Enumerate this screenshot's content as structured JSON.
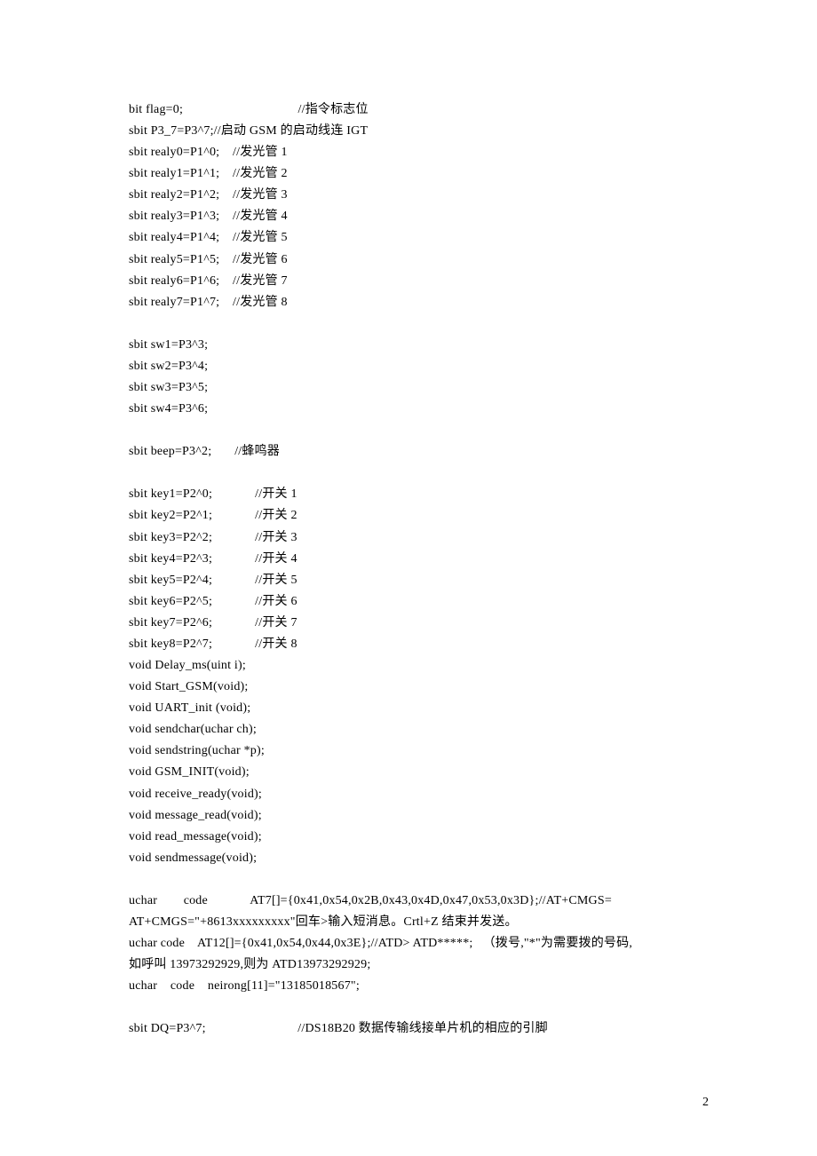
{
  "lines": [
    "bit flag=0;                                   //指令标志位",
    "sbit P3_7=P3^7;//启动 GSM 的启动线连 IGT",
    "sbit realy0=P1^0;    //发光管 1",
    "sbit realy1=P1^1;    //发光管 2",
    "sbit realy2=P1^2;    //发光管 3",
    "sbit realy3=P1^3;    //发光管 4",
    "sbit realy4=P1^4;    //发光管 5",
    "sbit realy5=P1^5;    //发光管 6",
    "sbit realy6=P1^6;    //发光管 7",
    "sbit realy7=P1^7;    //发光管 8",
    "",
    "sbit sw1=P3^3;",
    "sbit sw2=P3^4;",
    "sbit sw3=P3^5;",
    "sbit sw4=P3^6;",
    "",
    "sbit beep=P3^2;       //蜂鸣器",
    "",
    "sbit key1=P2^0;             //开关 1",
    "sbit key2=P2^1;             //开关 2",
    "sbit key3=P2^2;             //开关 3",
    "sbit key4=P2^3;             //开关 4",
    "sbit key5=P2^4;             //开关 5",
    "sbit key6=P2^5;             //开关 6",
    "sbit key7=P2^6;             //开关 7",
    "sbit key8=P2^7;             //开关 8",
    "void Delay_ms(uint i);",
    "void Start_GSM(void);",
    "void UART_init (void);",
    "void sendchar(uchar ch);",
    "void sendstring(uchar *p);",
    "void GSM_INIT(void);",
    "void receive_ready(void);",
    "void message_read(void);",
    "void read_message(void);",
    "void sendmessage(void);",
    "",
    "uchar        code             AT7[]={0x41,0x54,0x2B,0x43,0x4D,0x47,0x53,0x3D};//AT+CMGS=",
    "AT+CMGS=\"+8613xxxxxxxxx\"回车>输入短消息。Crtl+Z 结束并发送。",
    "uchar code    AT12[]={0x41,0x54,0x44,0x3E};//ATD> ATD*****;   （拨号,\"*\"为需要拨的号码,",
    "如呼叫 13973292929,则为 ATD13973292929;",
    "uchar    code    neirong[11]=\"13185018567\";",
    "",
    "sbit DQ=P3^7;                            //DS18B20 数据传输线接单片机的相应的引脚"
  ],
  "page_number": "2"
}
